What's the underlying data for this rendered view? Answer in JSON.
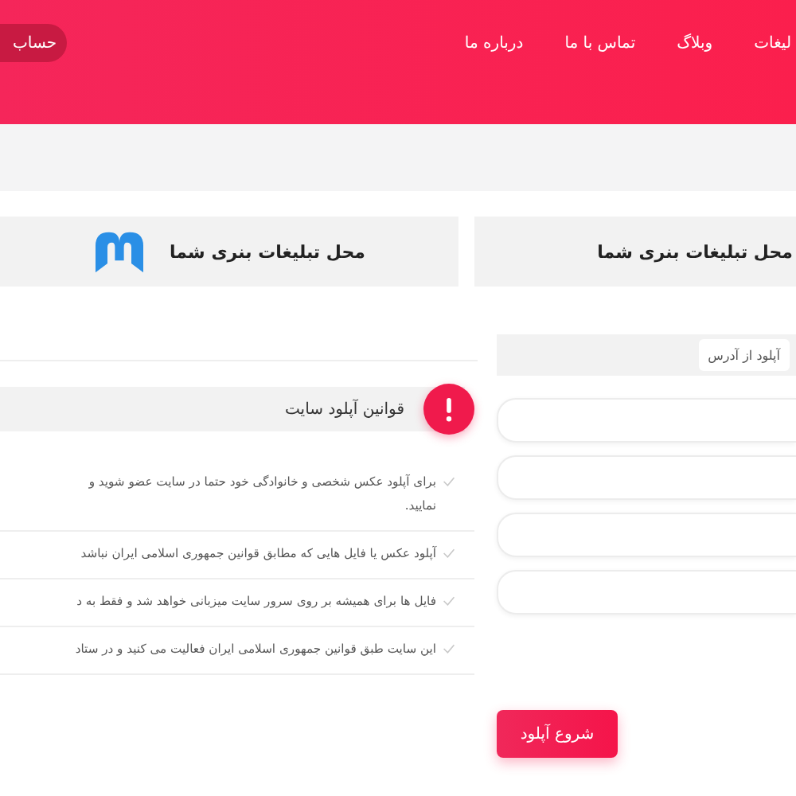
{
  "header": {
    "nav": [
      "لیغات",
      "وبلاگ",
      "تماس با ما",
      "درباره ما"
    ],
    "account_button": "حساب"
  },
  "banners": [
    {
      "text": "محل تبلیغات بنری شما",
      "logo": false
    },
    {
      "text": "محل تبلیغات بنری شما",
      "logo": true
    }
  ],
  "upload_form": {
    "tabs": [
      {
        "label": "آپلود از آدرس",
        "selected": true
      }
    ],
    "fields": [
      {
        "kind": "text"
      },
      {
        "kind": "text"
      },
      {
        "kind": "text"
      },
      {
        "kind": "text"
      }
    ],
    "button": "شروع آپلود"
  },
  "rules": {
    "title": "قوانین آپلود سایت",
    "items": [
      {
        "lines": [
          "برای آپلود عکس شخصی و خانوادگی خود حتما در سایت عضو شوید و",
          "نمایید."
        ]
      },
      {
        "lines": [
          "آپلود عکس یا فایل هایی که مطابق قوانین جمهوری اسلامی ایران نباشد"
        ]
      },
      {
        "lines": [
          "فایل ها برای همیشه بر روی سرور سایت میزبانی خواهد شد و فقط به د"
        ]
      },
      {
        "lines": [
          "این سایت طبق قوانین جمهوری اسلامی ایران فعالیت می کنید و در ستاد"
        ]
      }
    ]
  }
}
